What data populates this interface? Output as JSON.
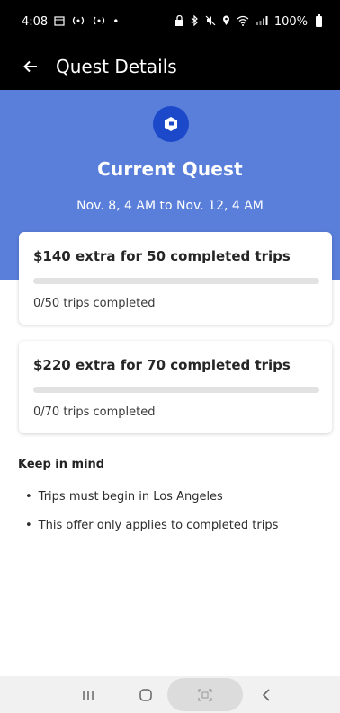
{
  "status_bar": {
    "time": "4:08",
    "left_icons": [
      "calendar-icon",
      "nfc-icon",
      "nfc-icon",
      "dot-icon"
    ],
    "right_icons": [
      "lock-icon",
      "bluetooth-icon",
      "mute-icon",
      "location-icon",
      "wifi-icon",
      "signal-icon"
    ],
    "battery": "100%"
  },
  "app_bar": {
    "back_icon": "arrow-left-icon",
    "title": "Quest Details"
  },
  "hero": {
    "background_color": "#5a7fdb",
    "logo_icon": "quest-logo-icon",
    "title": "Current Quest",
    "dates": "Nov. 8, 4 AM to Nov. 12, 4 AM"
  },
  "quests": [
    {
      "title": "$140 extra for 50 completed trips",
      "progress": 0,
      "status": "0/50 trips completed"
    },
    {
      "title": "$220 extra for 70 completed trips",
      "progress": 0,
      "status": "0/70 trips completed"
    }
  ],
  "keep_in_mind": {
    "heading": "Keep in mind",
    "items": [
      "Trips must begin in Los Angeles",
      "This offer only applies to completed trips"
    ]
  },
  "nav_bar": {
    "buttons": [
      "recents-icon",
      "home-icon",
      "scan-icon",
      "back-icon"
    ]
  }
}
